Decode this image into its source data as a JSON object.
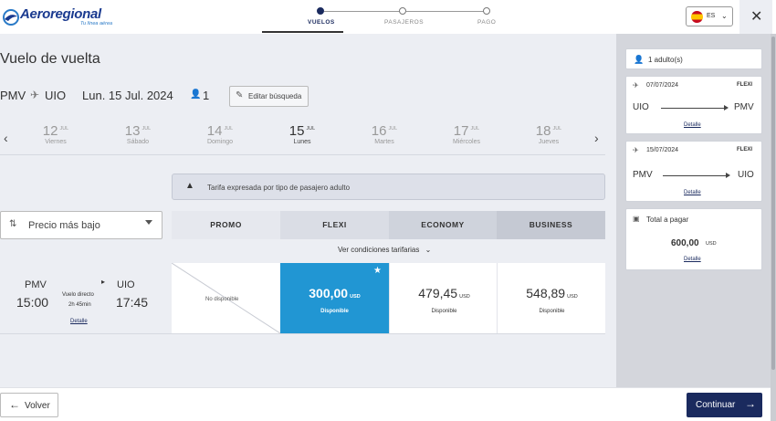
{
  "header": {
    "logo_text": "Aeroregional",
    "logo_tagline": "Tu línea aérea",
    "steps": [
      {
        "label": "Vuelos",
        "active": true
      },
      {
        "label": "Pasajeros",
        "active": false
      },
      {
        "label": "Pago",
        "active": false
      }
    ],
    "language": "ES"
  },
  "main": {
    "title": "Vuelo de vuelta",
    "route": {
      "origin": "PMV",
      "destination": "UIO",
      "date": "Lun. 15 Jul. 2024",
      "passengers": "1"
    },
    "edit_label": "Editar búsqueda",
    "dates": [
      {
        "day": "12",
        "month": "JUL",
        "weekday": "Viernes"
      },
      {
        "day": "13",
        "month": "JUL",
        "weekday": "Sábado"
      },
      {
        "day": "14",
        "month": "JUL",
        "weekday": "Domingo"
      },
      {
        "day": "15",
        "month": "JUL",
        "weekday": "Lunes",
        "active": true
      },
      {
        "day": "16",
        "month": "JUL",
        "weekday": "Martes"
      },
      {
        "day": "17",
        "month": "JUL",
        "weekday": "Miércoles"
      },
      {
        "day": "18",
        "month": "JUL",
        "weekday": "Jueves"
      }
    ],
    "notice": "Tarifa expresada por tipo de pasajero adulto",
    "sort_label": "Precio más bajo",
    "fare_headers": [
      "PROMO",
      "FLEXI",
      "ECONOMY",
      "BUSINESS"
    ],
    "conditions_label": "Ver condiciones tarifarias",
    "flight": {
      "origin": "PMV",
      "destination": "UIO",
      "depart": "15:00",
      "arrive": "17:45",
      "type": "Vuelo directo",
      "duration": "2h 45min",
      "detail_link": "Detalle"
    },
    "fares": [
      {
        "name": "PROMO",
        "status": "No disponible"
      },
      {
        "name": "FLEXI",
        "price": "300,00",
        "currency": "USD",
        "status": "Disponible",
        "selected": true
      },
      {
        "name": "ECONOMY",
        "price": "479,45",
        "currency": "USD",
        "status": "Disponible"
      },
      {
        "name": "BUSINESS",
        "price": "548,89",
        "currency": "USD",
        "status": "Disponible"
      }
    ]
  },
  "summary": {
    "passengers": "1 adulto(s)",
    "outbound": {
      "date": "07/07/2024",
      "fare": "FLEXI",
      "from": "UIO",
      "to": "PMV",
      "link": "Detalle"
    },
    "return": {
      "date": "15/07/2024",
      "fare": "FLEXI",
      "from": "PMV",
      "to": "UIO",
      "link": "Detalle"
    },
    "total_label": "Total a pagar",
    "total": "600,00",
    "total_currency": "USD",
    "total_link": "Detalle"
  },
  "footer": {
    "back_label": "Volver",
    "continue_label": "Continuar"
  },
  "colors": {
    "brand_navy": "#1a2a5e",
    "selected_fare": "#2196d3",
    "background": "#eceef3"
  }
}
